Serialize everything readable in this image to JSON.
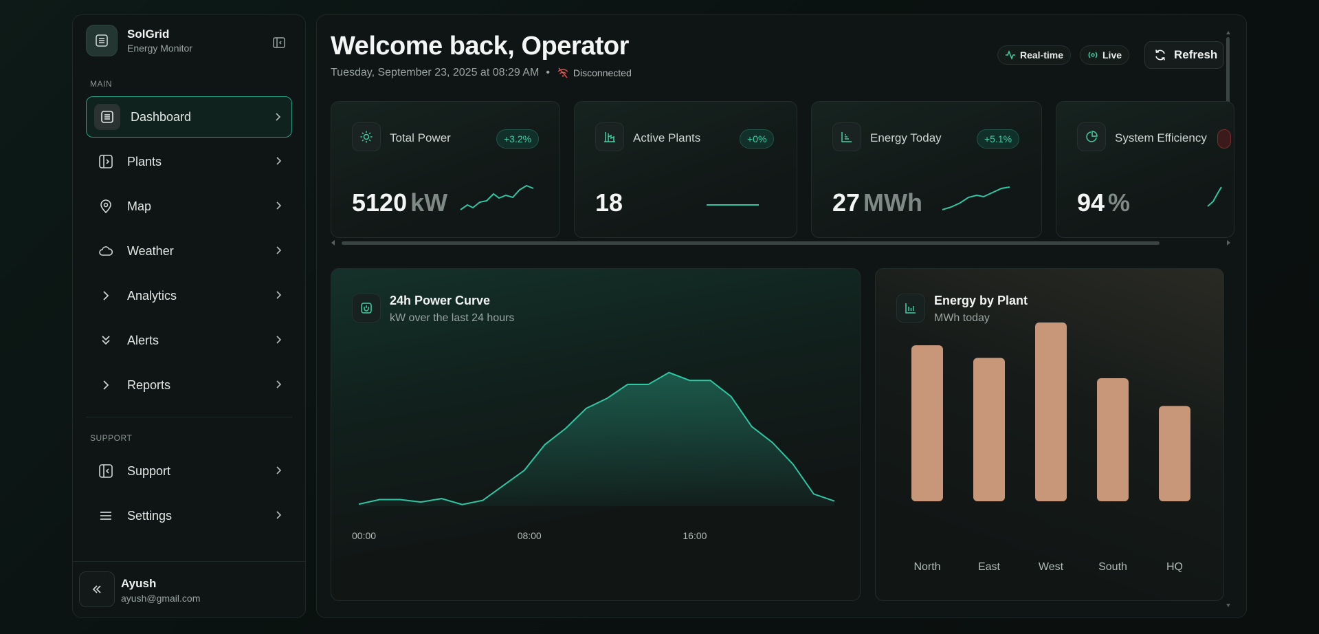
{
  "sidebar": {
    "brand_name": "SolGrid",
    "brand_sub": "Energy Monitor",
    "section_main": "MAIN",
    "section_support": "SUPPORT",
    "items": [
      {
        "label": "Dashboard",
        "icon": "dashboard-icon",
        "active": true
      },
      {
        "label": "Plants",
        "icon": "sidebar-panel-icon"
      },
      {
        "label": "Map",
        "icon": "map-pin-icon"
      },
      {
        "label": "Weather",
        "icon": "cloud-icon"
      },
      {
        "label": "Analytics",
        "icon": "chevron-right-icon"
      },
      {
        "label": "Alerts",
        "icon": "chevrons-down-icon"
      },
      {
        "label": "Reports",
        "icon": "chevron-right-icon"
      }
    ],
    "support_items": [
      {
        "label": "Support",
        "icon": "sidebar-left-icon"
      },
      {
        "label": "Settings",
        "icon": "menu-icon"
      }
    ],
    "user": {
      "name": "Ayush",
      "email": "ayush@gmail.com"
    }
  },
  "header": {
    "welcome": "Welcome back, Operator",
    "date": "Tuesday, September 23, 2025 at 08:29 AM",
    "separator": "•",
    "connection": "Disconnected",
    "chip_realtime": "Real-time",
    "chip_live": "Live",
    "refresh_label": "Refresh"
  },
  "stats": [
    {
      "title": "Total Power",
      "badge": "+3.2%",
      "value": "5120",
      "unit": "kW",
      "icon": "sun-icon"
    },
    {
      "title": "Active Plants",
      "badge": "+0%",
      "value": "18",
      "unit": "",
      "icon": "factory-icon"
    },
    {
      "title": "Energy Today",
      "badge": "+5.1%",
      "value": "27",
      "unit": "MWh",
      "icon": "bar-chart-icon"
    },
    {
      "title": "System Efficiency",
      "badge": "",
      "value": "94",
      "unit": "%",
      "icon": "pie-chart-icon"
    }
  ],
  "power_curve": {
    "title": "24h Power Curve",
    "subtitle": "kW over the last 24 hours"
  },
  "energy_by_plant": {
    "title": "Energy by Plant",
    "subtitle": "MWh today"
  },
  "chart_data": [
    {
      "type": "area",
      "title": "24h Power Curve",
      "subtitle": "kW over the last 24 hours",
      "x_ticks": [
        "00:00",
        "08:00",
        "16:00"
      ],
      "x": [
        0,
        1,
        2,
        3,
        4,
        5,
        6,
        7,
        8,
        9,
        10,
        11,
        12,
        13,
        14,
        15,
        16,
        17,
        18,
        19,
        20,
        21,
        22,
        23
      ],
      "values": [
        30,
        270,
        270,
        140,
        320,
        10,
        230,
        1010,
        1790,
        3140,
        3980,
        5030,
        5550,
        6280,
        6280,
        6900,
        6490,
        6490,
        5650,
        4080,
        3250,
        2110,
        560,
        190
      ],
      "color": "#2fc7a3"
    },
    {
      "type": "bar",
      "title": "Energy by Plant",
      "subtitle": "MWh today",
      "categories": [
        "North",
        "East",
        "West",
        "South",
        "HQ"
      ],
      "values": [
        18.5,
        17,
        21.2,
        14.6,
        11.3
      ],
      "color": "#c8977a"
    }
  ]
}
